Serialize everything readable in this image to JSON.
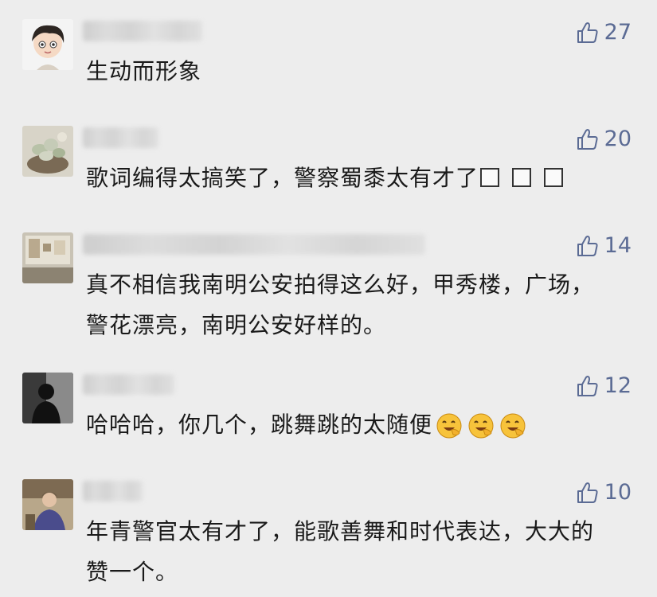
{
  "comments": [
    {
      "like_count": "27",
      "text": "生动而形象",
      "avatar": "cartoon-boy-avatar",
      "trailing_icons": []
    },
    {
      "like_count": "20",
      "text": "歌词编得太搞笑了，警察蜀黍太有才了",
      "avatar": "succulent-plant-avatar",
      "trailing_icons": [
        "missing-glyph-box",
        "missing-glyph-box",
        "missing-glyph-box"
      ]
    },
    {
      "like_count": "14",
      "text": "真不相信我南明公安拍得这么好，甲秀楼，广场，\n警花漂亮，南明公安好样的。",
      "avatar": "room-photo-avatar",
      "trailing_icons": []
    },
    {
      "like_count": "12",
      "text": "哈哈哈，你几个，跳舞跳的太随便",
      "avatar": "silhouette-avatar",
      "trailing_icons": [
        "laughing-emoji",
        "laughing-emoji",
        "laughing-emoji"
      ]
    },
    {
      "like_count": "10",
      "text": "年青警官太有才了，能歌善舞和时代表达，大大的\n赞一个。",
      "avatar": "person-photo-avatar",
      "trailing_icons": []
    }
  ],
  "colors": {
    "background": "#ededed",
    "like": "#5b6b94",
    "text": "#1a1a1a"
  }
}
